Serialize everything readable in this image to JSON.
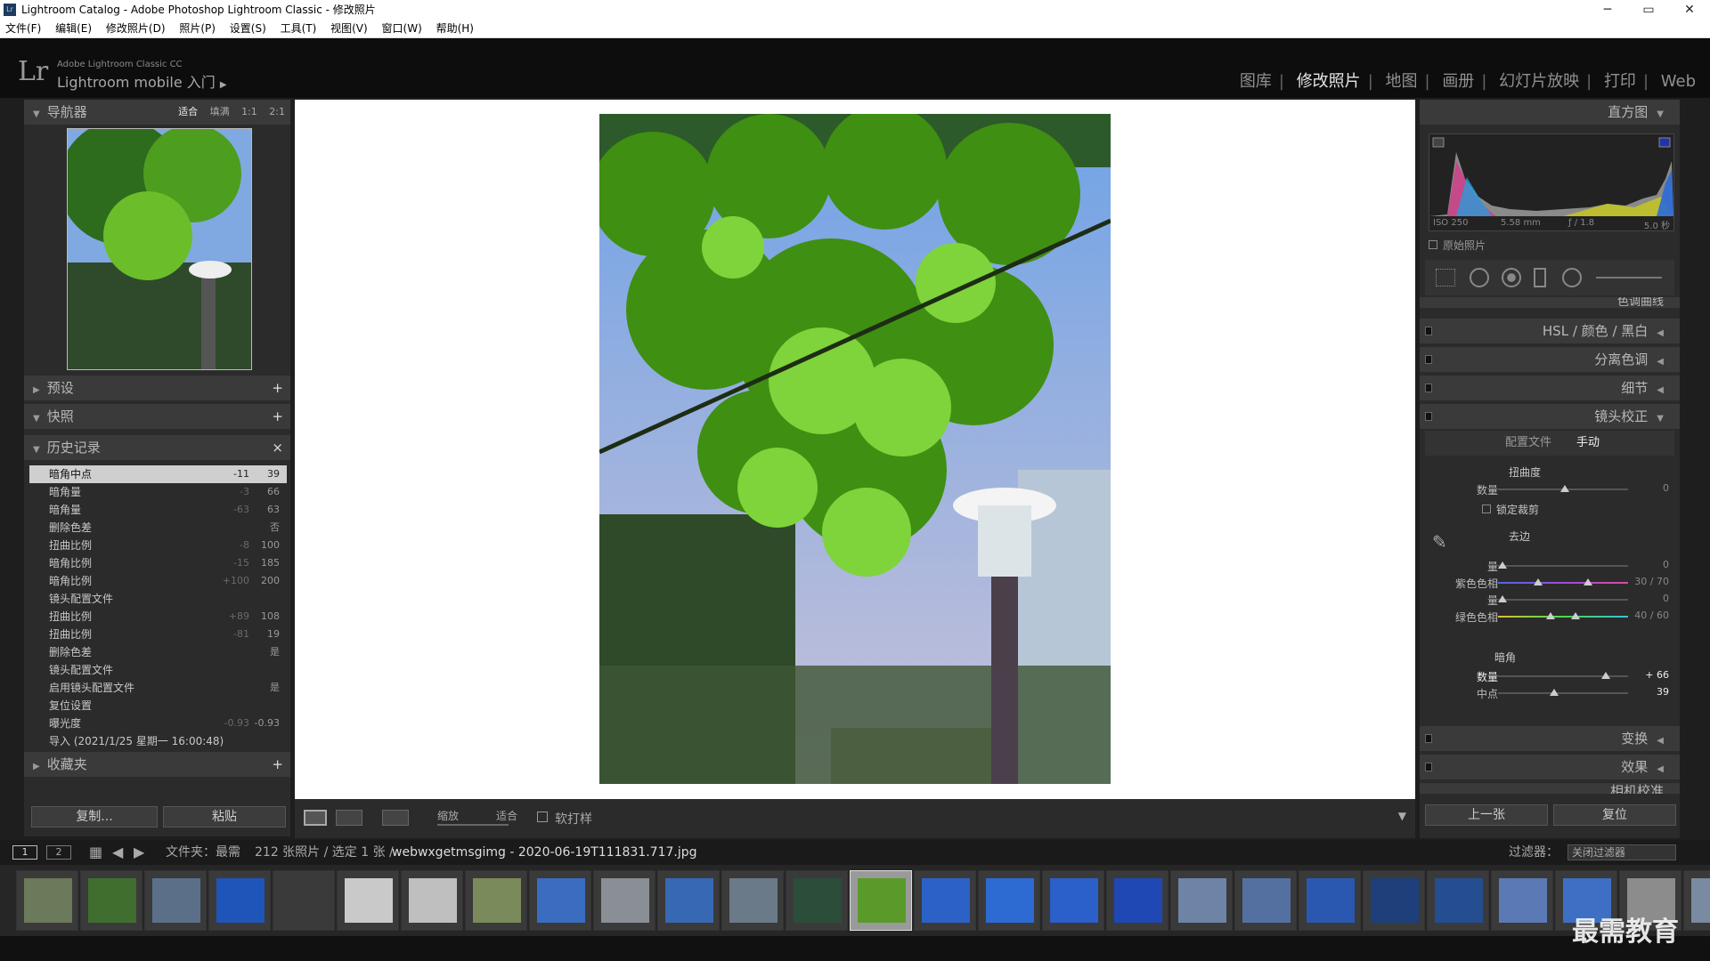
{
  "window": {
    "title": "Lightroom Catalog - Adobe Photoshop Lightroom Classic - 修改照片",
    "icon": "Lr",
    "minimize": "─",
    "maximize": "▭",
    "close": "✕"
  },
  "menu": [
    "文件(F)",
    "编辑(E)",
    "修改照片(D)",
    "照片(P)",
    "设置(S)",
    "工具(T)",
    "视图(V)",
    "窗口(W)",
    "帮助(H)"
  ],
  "identity": {
    "logo": "Lr",
    "small": "Adobe Lightroom Classic CC",
    "big": "Lightroom mobile 入门",
    "arrow": "▶"
  },
  "modules": [
    "图库",
    "修改照片",
    "地图",
    "画册",
    "幻灯片放映",
    "打印",
    "Web"
  ],
  "left": {
    "navigator": {
      "title": "导航器",
      "options": [
        "适合",
        "填满",
        "1:1",
        "2:1"
      ]
    },
    "presets": {
      "title": "预设"
    },
    "snapshots": {
      "title": "快照"
    },
    "history": {
      "title": "历史记录",
      "items": [
        {
          "name": "暗角中点",
          "a": "-11",
          "b": "39"
        },
        {
          "name": "暗角量",
          "a": "-3",
          "b": "66"
        },
        {
          "name": "暗角量",
          "a": "-63",
          "b": "63"
        },
        {
          "name": "删除色差",
          "a": "",
          "b": "否"
        },
        {
          "name": "扭曲比例",
          "a": "-8",
          "b": "100"
        },
        {
          "name": "暗角比例",
          "a": "-15",
          "b": "185"
        },
        {
          "name": "暗角比例",
          "a": "+100",
          "b": "200"
        },
        {
          "name": "镜头配置文件",
          "a": "",
          "b": ""
        },
        {
          "name": "扭曲比例",
          "a": "+89",
          "b": "108"
        },
        {
          "name": "扭曲比例",
          "a": "-81",
          "b": "19"
        },
        {
          "name": "删除色差",
          "a": "",
          "b": "是"
        },
        {
          "name": "镜头配置文件",
          "a": "",
          "b": ""
        },
        {
          "name": "启用镜头配置文件",
          "a": "",
          "b": "是"
        },
        {
          "name": "复位设置",
          "a": "",
          "b": ""
        },
        {
          "name": "曝光度",
          "a": "-0.93",
          "b": "-0.93"
        },
        {
          "name": "导入 (2021/1/25 星期一 16:00:48)",
          "a": "",
          "b": ""
        }
      ]
    },
    "collections": {
      "title": "收藏夹"
    },
    "copy_btn": "复制...",
    "paste_btn": "粘贴"
  },
  "toolbar": {
    "zoom_label": "缩放",
    "fit_label": "适合",
    "softproof": "软打样"
  },
  "right": {
    "histogram_title": "直方图",
    "exif": {
      "iso": "ISO 250",
      "focal": "5.58 mm",
      "aperture": "ƒ / 1.8",
      "shutter": "5.0 秒"
    },
    "original": "原始照片",
    "panels_top": [
      "色调曲线"
    ],
    "hsl": {
      "a": "HSL",
      "b": "颜色",
      "c": "黑白"
    },
    "split": "分离色调",
    "detail": "细节",
    "lens": "镜头校正",
    "lens_tabs": {
      "profile": "配置文件",
      "manual": "手动"
    },
    "distortion": {
      "title": "扭曲度",
      "amount_label": "数量",
      "amount": "0",
      "constrain": "锁定裁剪"
    },
    "defringe": {
      "title": "去边",
      "rows": [
        {
          "label": "量",
          "value": "0"
        },
        {
          "label": "紫色色相",
          "value": "30 / 70"
        },
        {
          "label": "量",
          "value": "0"
        },
        {
          "label": "绿色色相",
          "value": "40 / 60"
        }
      ]
    },
    "vignette": {
      "title": "暗角",
      "amount_label": "数量",
      "amount": "+ 66",
      "mid_label": "中点",
      "mid": "39"
    },
    "transform": "变换",
    "effects": "效果",
    "calibration": "相机校准",
    "prev_btn": "上一张",
    "reset_btn": "复位"
  },
  "filmbar": {
    "p1": "1",
    "p2": "2",
    "folder": "文件夹：最需",
    "count": "212 张照片 / 选定 1 张 /",
    "filename": "webwxgetmsgimg - 2020-06-19T111831.717.jpg",
    "filter_label": "过滤器：",
    "filter_value": "关闭过滤器"
  },
  "thumb_colors": [
    "#6a7a5a",
    "#3f6e2e",
    "#5b7088",
    "#1f55b8",
    "#3a3a3a",
    "#c9c9c9",
    "#bfbfbf",
    "#7b8a5a",
    "#3a6cc0",
    "#8a8f96",
    "#3768b3",
    "#6a7a88",
    "#2b4d3a",
    "#5a9a2a",
    "#2c62c7",
    "#2d6ad2",
    "#2b5fc9",
    "#1f48b5",
    "#6d84a6",
    "#5470a0",
    "#2a58b0",
    "#1e3f7a",
    "#244e8f",
    "#5b79b5",
    "#3d6fc4",
    "#8c8c8c",
    "#7a8aa0"
  ],
  "watermark": "最需教育"
}
